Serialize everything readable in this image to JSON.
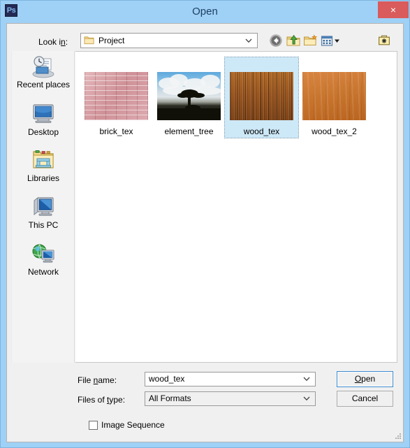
{
  "window": {
    "app_icon": "photoshop-icon",
    "app_icon_text": "Ps",
    "title": "Open",
    "close_label": "×",
    "frame_color": "#9fd0f5",
    "close_color": "#d95b5b"
  },
  "lookin": {
    "label": "Look in:",
    "value": "Project",
    "icon": "folder-icon",
    "arrow": "⌄"
  },
  "toolbar": {
    "buttons": [
      {
        "name": "back-button",
        "tip": "Back"
      },
      {
        "name": "up-one-level-button",
        "tip": "Up One Level"
      },
      {
        "name": "create-new-folder-button",
        "tip": "Create New Folder"
      },
      {
        "name": "views-button",
        "tip": "Views"
      },
      {
        "name": "favorites-folder-button",
        "tip": "Favorites"
      }
    ]
  },
  "places": {
    "items": [
      {
        "label": "Recent places",
        "icon": "recent-places-icon"
      },
      {
        "label": "Desktop",
        "icon": "desktop-icon"
      },
      {
        "label": "Libraries",
        "icon": "libraries-icon"
      },
      {
        "label": "This PC",
        "icon": "this-pc-icon"
      },
      {
        "label": "Network",
        "icon": "network-icon"
      }
    ]
  },
  "files": {
    "items": [
      {
        "label": "brick_tex",
        "texture": "tex-brick",
        "selected": false
      },
      {
        "label": "element_tree",
        "texture": "tex-tree",
        "selected": false
      },
      {
        "label": "wood_tex",
        "texture": "tex-wood",
        "selected": true
      },
      {
        "label": "wood_tex_2",
        "texture": "tex-wood2",
        "selected": false
      }
    ],
    "selected_color": "#cde8f7"
  },
  "form": {
    "filename_label": "File name:",
    "filename_value": "wood_tex",
    "filetype_label": "Files of type:",
    "filetype_value": "All Formats",
    "open_label": "Open",
    "cancel_label": "Cancel",
    "image_sequence_label": "Image Sequence",
    "image_sequence_checked": false,
    "arrow": "⌄"
  }
}
